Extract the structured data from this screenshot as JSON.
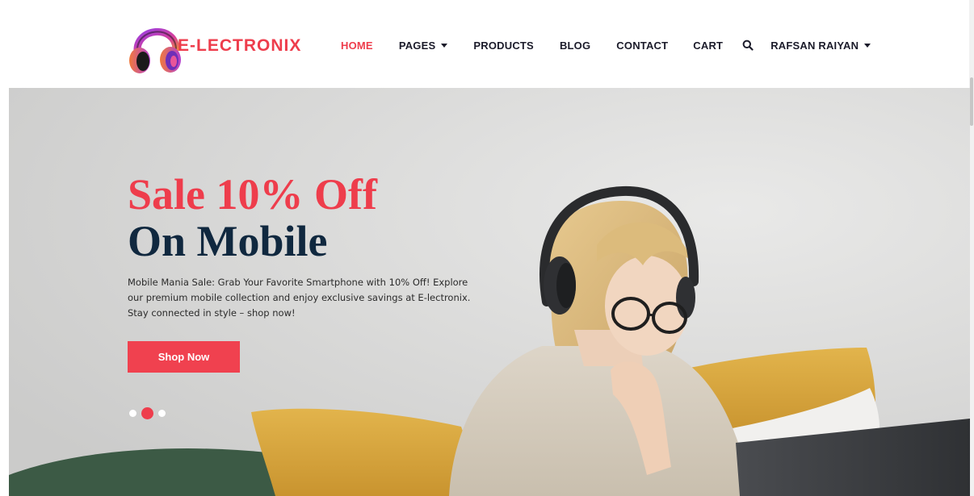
{
  "brand": {
    "name": "E-LECTRONIX",
    "colors": {
      "accent": "#ee3d4c",
      "dark": "#10283f",
      "logo_purple": "#8e3fd6",
      "logo_orange": "#f08a3c"
    }
  },
  "nav": {
    "items": [
      {
        "label": "HOME",
        "active": true,
        "dropdown": false
      },
      {
        "label": "PAGES",
        "active": false,
        "dropdown": true
      },
      {
        "label": "PRODUCTS",
        "active": false,
        "dropdown": false
      },
      {
        "label": "BLOG",
        "active": false,
        "dropdown": false
      },
      {
        "label": "CONTACT",
        "active": false,
        "dropdown": false
      },
      {
        "label": "CART",
        "active": false,
        "dropdown": false
      }
    ],
    "search_icon": "search-icon",
    "user": {
      "label": "RAFSAN RAIYAN",
      "dropdown": true
    }
  },
  "hero": {
    "title_line1": "Sale 10% Off",
    "title_line2": "On Mobile",
    "description": "Mobile Mania Sale: Grab Your Favorite Smartphone with 10% Off! Explore our premium mobile collection and enjoy exclusive savings at E-lectronix. Stay connected in style – shop now!",
    "button_label": "Shop Now",
    "slides": {
      "count": 3,
      "active_index": 1
    }
  }
}
